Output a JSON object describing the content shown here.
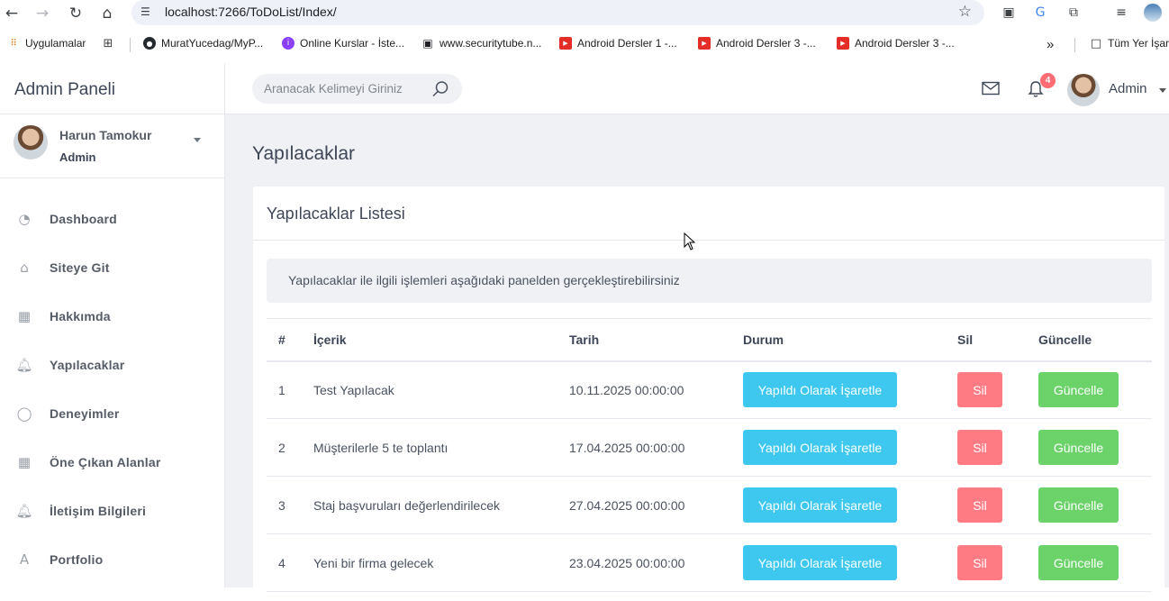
{
  "browser": {
    "url": "localhost:7266/ToDoList/Index/",
    "bookmarks": [
      {
        "label": "Uygulamalar",
        "icon": "apps-grid-icon"
      },
      {
        "label": "MuratYucedag/MyP...",
        "icon": "github-icon"
      },
      {
        "label": "Online Kurslar - İste...",
        "icon": "kurs-icon"
      },
      {
        "label": "www.securitytube.n...",
        "icon": "tv-icon"
      },
      {
        "label": "Android Dersler 1 -...",
        "icon": "youtube-icon"
      },
      {
        "label": "Android Dersler 3 -...",
        "icon": "youtube-icon"
      },
      {
        "label": "Android Dersler 3 -...",
        "icon": "youtube-icon"
      }
    ],
    "bookmarks_overflow": "»",
    "all_bookmarks": "Tüm Yer İşar"
  },
  "sidebar": {
    "brand": "Admin Paneli",
    "profile": {
      "name": "Harun Tamokur",
      "role": "Admin"
    },
    "items": [
      {
        "label": "Dashboard",
        "icon": "gauge-icon"
      },
      {
        "label": "Siteye Git",
        "icon": "home-icon"
      },
      {
        "label": "Hakkımda",
        "icon": "grid-icon"
      },
      {
        "label": "Yapılacaklar",
        "icon": "bell-icon"
      },
      {
        "label": "Deneyimler",
        "icon": "apple-icon"
      },
      {
        "label": "Öne Çıkan Alanlar",
        "icon": "table-icon"
      },
      {
        "label": "İletişim Bilgileri",
        "icon": "bell-icon"
      },
      {
        "label": "Portfolio",
        "icon": "letter-a-icon"
      }
    ]
  },
  "topbar": {
    "search_placeholder": "Aranacak Kelimeyi Giriniz",
    "notification_count": "4",
    "user_name": "Admin"
  },
  "main": {
    "page_title": "Yapılacaklar",
    "card_title": "Yapılacaklar Listesi",
    "info_text": "Yapılacaklar ile ilgili işlemleri aşağıdaki panelden gerçekleştirebilirsiniz",
    "table": {
      "headers": [
        "#",
        "İçerik",
        "Tarih",
        "Durum",
        "Sil",
        "Güncelle"
      ],
      "rows": [
        {
          "num": "1",
          "content": "Test Yapılacak",
          "date": "10.11.2025 00:00:00",
          "status_btn": "Yapıldı Olarak İşaretle",
          "delete_btn": "Sil",
          "update_btn": "Güncelle"
        },
        {
          "num": "2",
          "content": "Müşterilerle 5 te toplantı",
          "date": "17.04.2025 00:00:00",
          "status_btn": "Yapıldı Olarak İşaretle",
          "delete_btn": "Sil",
          "update_btn": "Güncelle"
        },
        {
          "num": "3",
          "content": "Staj başvuruları değerlendirilecek",
          "date": "27.04.2025 00:00:00",
          "status_btn": "Yapıldı Olarak İşaretle",
          "delete_btn": "Sil",
          "update_btn": "Güncelle"
        },
        {
          "num": "4",
          "content": "Yeni bir firma gelecek",
          "date": "23.04.2025 00:00:00",
          "status_btn": "Yapıldı Olarak İşaretle",
          "delete_btn": "Sil",
          "update_btn": "Güncelle"
        }
      ]
    }
  },
  "colors": {
    "done_button": "#3ec8f0",
    "delete_button": "#ff7b84",
    "update_button": "#6bd36a",
    "badge": "#ff6b72",
    "content_bg": "#f0f1f5"
  }
}
